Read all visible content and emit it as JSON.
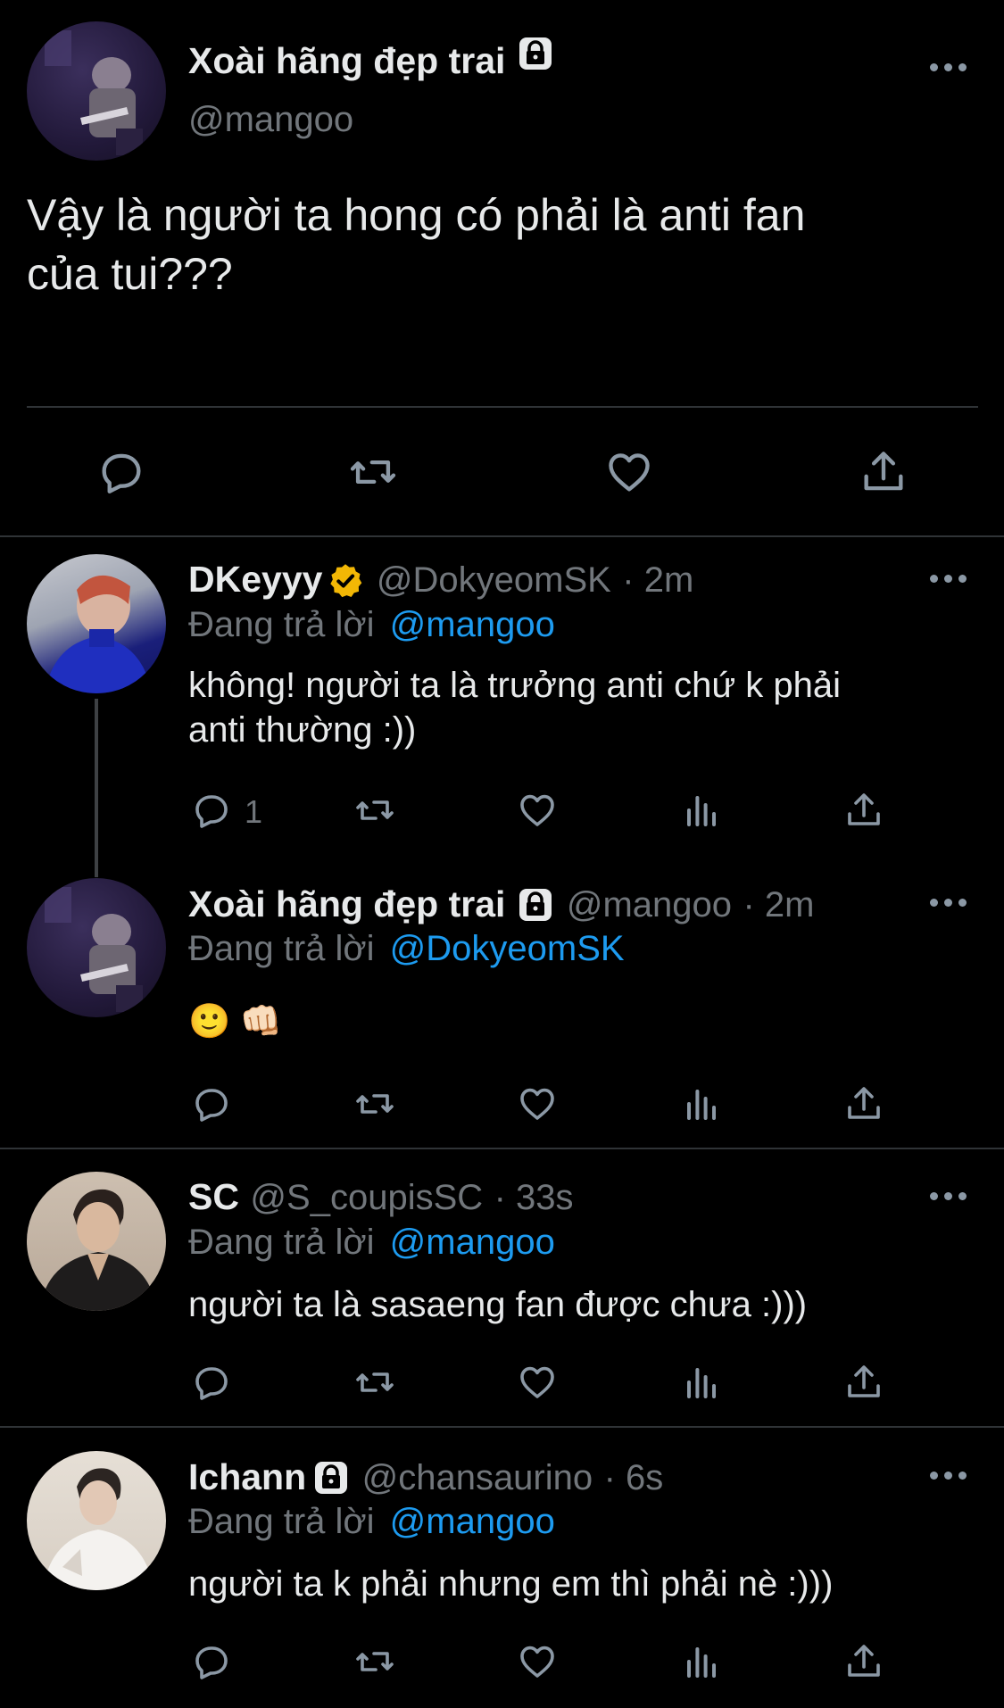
{
  "main_tweet": {
    "author_name": "Xoài hãng đẹp trai",
    "handle": "@mangoo",
    "text_line1": "Vậy là người ta hong có phải là anti fan",
    "text_line2": "của tui???"
  },
  "replies": [
    {
      "author_name": "DKeyyy",
      "handle": "@DokyeomSK",
      "time": "· 2m",
      "replying_prefix": "Đang trả lời",
      "replying_to": "@mangoo",
      "text_line1": "không! người ta là trưởng anti chứ k phải",
      "text_line2": "anti thường :))",
      "reply_count": "1"
    },
    {
      "author_name": "Xoài hãng đẹp trai",
      "handle": "@mangoo",
      "time": "· 2m",
      "replying_prefix": "Đang trả lời",
      "replying_to": "@DokyeomSK",
      "text_line1": "🙂 👊🏻"
    },
    {
      "author_name": "SC",
      "handle": "@S_coupisSC",
      "time": "· 33s",
      "replying_prefix": "Đang trả lời",
      "replying_to": "@mangoo",
      "text_line1": "người ta là sasaeng fan được chưa :)))"
    },
    {
      "author_name": "Ichann",
      "handle": "@chansaurino",
      "time": "· 6s",
      "replying_prefix": "Đang trả lời",
      "replying_to": "@mangoo",
      "text_line1": "người ta k phải nhưng em thì phải nè :)))"
    }
  ],
  "icons": [
    "more-icon",
    "lock-icon",
    "verified-badge-icon",
    "reply-icon",
    "retweet-icon",
    "like-icon",
    "views-icon",
    "share-icon"
  ],
  "colors": {
    "background": "#000000",
    "text": "#e7e9ea",
    "muted": "#71767b",
    "link": "#1d9bf0",
    "verified": "#f4b400",
    "divider": "#2f3336"
  }
}
